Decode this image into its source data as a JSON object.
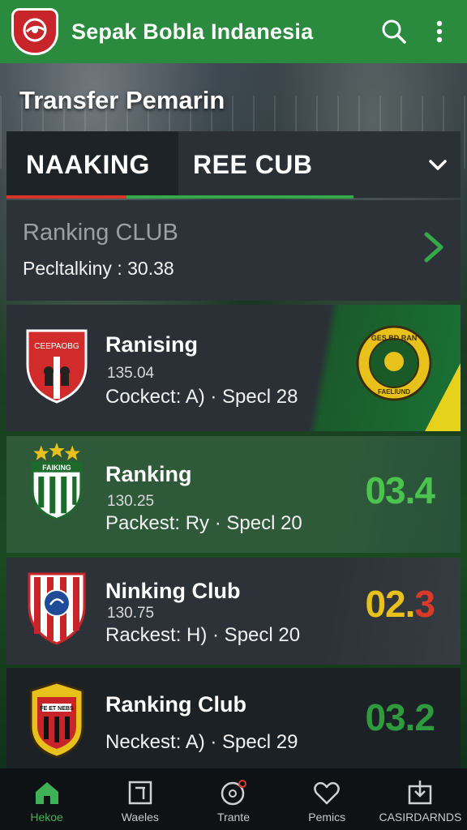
{
  "app": {
    "title": "Sepak Bobla Indanesia"
  },
  "page": {
    "title": "Transfer Pemarin"
  },
  "tabs": [
    {
      "label": "NAAKING",
      "active": true
    },
    {
      "label": "REE CUB",
      "active": false
    }
  ],
  "summary": {
    "title": "Ranking CLUB",
    "subtitle": "Pecltalkiny : 30.38"
  },
  "clubs": [
    {
      "name": "Ranising",
      "date": "135.04",
      "meta": "Cockect: A) · Specl 28",
      "score": "",
      "crest_text": "CEEPAOBG",
      "badge_text": "GES BD RAN",
      "badge_bottom": "FAELIUND"
    },
    {
      "name": "Ranking",
      "date": "130.25",
      "meta": "Packest: Ry · Specl 20",
      "score": "03.4",
      "crest_text": "FAIKING"
    },
    {
      "name": "Ninking Club",
      "date": "130.75",
      "meta": "Rackest: H) · Specl 20",
      "score": "02.3"
    },
    {
      "name": "Ranking Club",
      "date": "",
      "meta": "Neckest: A) · Specl 29",
      "score": "03.2",
      "crest_text": "FE ET NEBS"
    }
  ],
  "colors": {
    "header_green": "#2a8a3e",
    "accent_green": "#35a94a",
    "accent_red": "#d8352a",
    "score_green": "#4cc34f",
    "score_yellow": "#e8c21a",
    "score_red": "#d93a2a",
    "score_dark_green": "#2f9a3e"
  },
  "bottom_nav": [
    {
      "label": "Hekoe",
      "icon": "home-icon",
      "active": true
    },
    {
      "label": "Waeles",
      "icon": "square-frame-icon",
      "active": false
    },
    {
      "label": "Trante",
      "icon": "ball-icon",
      "active": false
    },
    {
      "label": "Pemics",
      "icon": "heart-icon",
      "active": false
    },
    {
      "label": "CASIRDARNDS",
      "icon": "download-box-icon",
      "active": false
    }
  ]
}
